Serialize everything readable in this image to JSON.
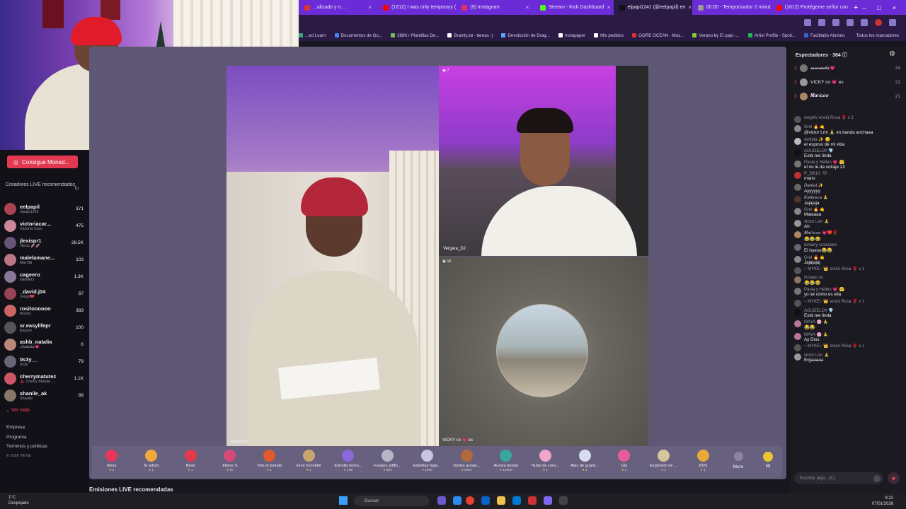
{
  "browser": {
    "tabs": [
      {
        "label": "...alizado y n...",
        "color": "#d33"
      },
      {
        "label": "(1612) I was only temporary (",
        "color": "#f00"
      },
      {
        "label": "(9) Instagram",
        "color": "#e1306c"
      },
      {
        "label": "Stream - Kick Dashboard",
        "color": "#53fc18"
      },
      {
        "label": "elpapi1241 (@eelpapil) en",
        "color": "#111",
        "active": true
      },
      {
        "label": "00:00 - Temporizador 2 minut",
        "color": "#999"
      },
      {
        "label": "(1612) Protégeme señor con",
        "color": "#f00"
      }
    ],
    "bookmarks": [
      {
        "label": "...ed Learn",
        "color": "#3a7"
      },
      {
        "label": "Documentos de Go...",
        "color": "#4285f4"
      },
      {
        "label": "288K+ Plantillas De...",
        "color": "#7b5"
      },
      {
        "label": "Brainly.lat - tareas :)",
        "color": "#fff"
      },
      {
        "label": "Devolución de Drag...",
        "color": "#5af"
      },
      {
        "label": "Instapaper",
        "color": "#fff"
      },
      {
        "label": "Mis pedidos",
        "color": "#fff"
      },
      {
        "label": "GORE OCEAN - Mus...",
        "color": "#d33"
      },
      {
        "label": "Verano by El papi -...",
        "color": "#8c3"
      },
      {
        "label": "Artist Profile - Spoti...",
        "color": "#1db954"
      },
      {
        "label": "Facilitatio Alumno",
        "color": "#36c"
      }
    ],
    "all_bookmarks": "Todos los marcadores"
  },
  "sidebar": {
    "coins_button": "Consigue Moned...",
    "creators_title": "Creadores LIVE recomendados",
    "creators": [
      {
        "name": "eelpapil",
        "sub": "elpapi1241",
        "count": "371",
        "color": "#a45"
      },
      {
        "name": "victoriacar...",
        "sub": "Victoria Caro",
        "count": "475",
        "color": "#c89"
      },
      {
        "name": "jlexispr1",
        "sub": "Jlexis 🚀🚀",
        "count": "28.5K",
        "color": "#657"
      },
      {
        "name": "malelamane...",
        "sub": "Mai B$",
        "count": "103",
        "color": "#b78"
      },
      {
        "name": "cageero",
        "sub": "GEERO",
        "count": "1.3K",
        "color": "#879"
      },
      {
        "name": "_david.j04",
        "sub": "Jesús💔",
        "count": "67",
        "color": "#945"
      },
      {
        "name": "rositoooooo",
        "sub": "Rosito",
        "count": "383",
        "color": "#c66"
      },
      {
        "name": "sr.easylifepr",
        "sub": "Easyre",
        "count": "100",
        "color": "#555"
      },
      {
        "name": "ashb_natalia",
        "sub": "𝓝𝓪𝓽𝓪𝓵𝓲𝓪💗",
        "count": "6",
        "color": "#b87"
      },
      {
        "name": "0s3y__",
        "sub": "0s3y",
        "count": "79",
        "color": "#667"
      },
      {
        "name": "cherrymatutez",
        "sub": "🍒 Cherry Matute ...",
        "count": "1.1K",
        "color": "#c56"
      },
      {
        "name": "shanile_ak",
        "sub": "Shanile",
        "count": "89",
        "color": "#876"
      }
    ],
    "see_all": "Ver todo",
    "footer_links": [
      "Empresa",
      "Programa",
      "Términos y políticas"
    ],
    "copyright": "© 2026 TikTok"
  },
  "stage": {
    "host_label": "elpapi1241",
    "guest1_viewers": "7",
    "guest1_label": "Vergara_DJ",
    "guest2_viewers": "16",
    "guest2_label": "VICKY co 💗 es"
  },
  "gifts": [
    {
      "name": "Rosa",
      "price": "1",
      "color": "#e8365a"
    },
    {
      "name": "Te adoro",
      "price": "1",
      "color": "#f2a93b"
    },
    {
      "name": "Beso",
      "price": "1",
      "color": "#e23a4a"
    },
    {
      "name": "Flores S",
      "price": "20",
      "color": "#d64a7a"
    },
    {
      "name": "Tom el tomate",
      "price": "1",
      "color": "#e05a2c"
    },
    {
      "name": "Eres increíble",
      "price": "1",
      "color": "#c9a56e"
    },
    {
      "name": "Estrella noctu...",
      "price": "199",
      "color": "#8a6ad8"
    },
    {
      "name": "Fuegos artific...",
      "price": "500",
      "color": "#b8b6c4"
    },
    {
      "name": "Estrellas fuga...",
      "price": "1000",
      "color": "#c9c5e0"
    },
    {
      "name": "Tardes acoge...",
      "price": "4000",
      "color": "#b36a3a"
    },
    {
      "name": "Aurora boreal",
      "price": "12000",
      "color": "#3aa6a0"
    },
    {
      "name": "Nube de cora...",
      "price": "1",
      "color": "#f0a6c8"
    },
    {
      "name": "Alas de guard...",
      "price": "1",
      "color": "#d8dcef"
    },
    {
      "name": "GG",
      "price": "1",
      "color": "#e85a9a"
    },
    {
      "name": "Explosión de ...",
      "price": "1",
      "color": "#d6c79a"
    },
    {
      "name": "2026",
      "price": "1",
      "color": "#e8a83a"
    }
  ],
  "more_label": "More",
  "coin_balance": "58",
  "live_recommended": "Emisiones LIVE recomendadas",
  "chat": {
    "viewers_title": "Espectadores · 364",
    "top_viewers": [
      {
        "rank": "1",
        "name": "𝓶𝓪𝓷𝓾𝓮𝓵𝓪💗",
        "score": "24",
        "color": "#777"
      },
      {
        "rank": "2",
        "name": "VICKY co 💗 es",
        "score": "21",
        "color": "#999"
      },
      {
        "rank": "3",
        "name": "𝑴𝒂𝒓𝒊𝒄𝒐𝒐",
        "score": "21",
        "color": "#a86"
      }
    ],
    "messages": [
      {
        "user": "AngelV envió Rosa 🌹 x 1",
        "text": "",
        "color": "#555"
      },
      {
        "user": "Grel 🔥 🤙",
        "text": "@victor Lmr 🙏 en banda anchaaa",
        "color": "#888"
      },
      {
        "user": "Ambita ✨ 😊",
        "text": "el esposo de mi vida",
        "color": "#bbb"
      },
      {
        "user": "AGUDELO!! 💎",
        "text": "Está ree linda",
        "color": "#111"
      },
      {
        "user": "Paola y Hellen 💗 🤗",
        "text": "el no le da voltaje 23",
        "color": "#777"
      },
      {
        "user": "P_DB10. 🖤",
        "text": "mano",
        "color": "#b33"
      },
      {
        "user": "𝑫𝒂𝒏𝒊𝒆𝒍 ✨",
        "text": "Ayyyyyy",
        "color": "#666"
      },
      {
        "user": "𝑲𝒂𝒕𝒍𝒆𝒔𝒄𝒂 🙏",
        "text": "Jajajaja",
        "color": "#533"
      },
      {
        "user": "Grel 🔥 🤙",
        "text": "Malaaaa",
        "color": "#888"
      },
      {
        "user": "victor Lmr 🙏",
        "text": "Ah",
        "color": "#999"
      },
      {
        "user": "𝑴𝒂𝒓𝒊𝒄𝒐𝒐 💗❤️🌹",
        "text": "😂😂😂",
        "color": "#a86"
      },
      {
        "user": "Ismany Gonzales",
        "text": "El hueso😂😂",
        "color": "#667"
      },
      {
        "user": "Grel 🔥 🤙",
        "text": "Jajajajaj",
        "color": "#888"
      },
      {
        "user": "~ MYKE~ 👑 envió Rosa 🌹 x 1",
        "text": "",
        "color": "#555"
      },
      {
        "user": "Ronald co",
        "text": "😂😂😂",
        "color": "#876"
      },
      {
        "user": "Paola y Hellen 💗 🤗",
        "text": "yo sé cómo es ella",
        "color": "#777"
      },
      {
        "user": "~ MYKE~ 👑 envió Rosa 🌹 x 1",
        "text": "",
        "color": "#555"
      },
      {
        "user": "AGUDELO!! 💎",
        "text": "Está ree linda",
        "color": "#111"
      },
      {
        "user": "MAYA 🌸 🙏",
        "text": "😂😂",
        "color": "#b79"
      },
      {
        "user": "MAYA 🌸 🙏",
        "text": "Ay Dios",
        "color": "#b79"
      },
      {
        "user": "~ MYKE~ 👑 envió Rosa 🌹 x 1",
        "text": "",
        "color": "#555"
      },
      {
        "user": "victor Lmr 🙏",
        "text": "Ergaaaaa",
        "color": "#999"
      }
    ],
    "input_placeholder": "Escribe algo...(C)"
  },
  "taskbar": {
    "weather_temp": "1°C",
    "weather_desc": "Despejado",
    "search": "Buscar",
    "time": "9:22",
    "date": "07/01/2026"
  }
}
